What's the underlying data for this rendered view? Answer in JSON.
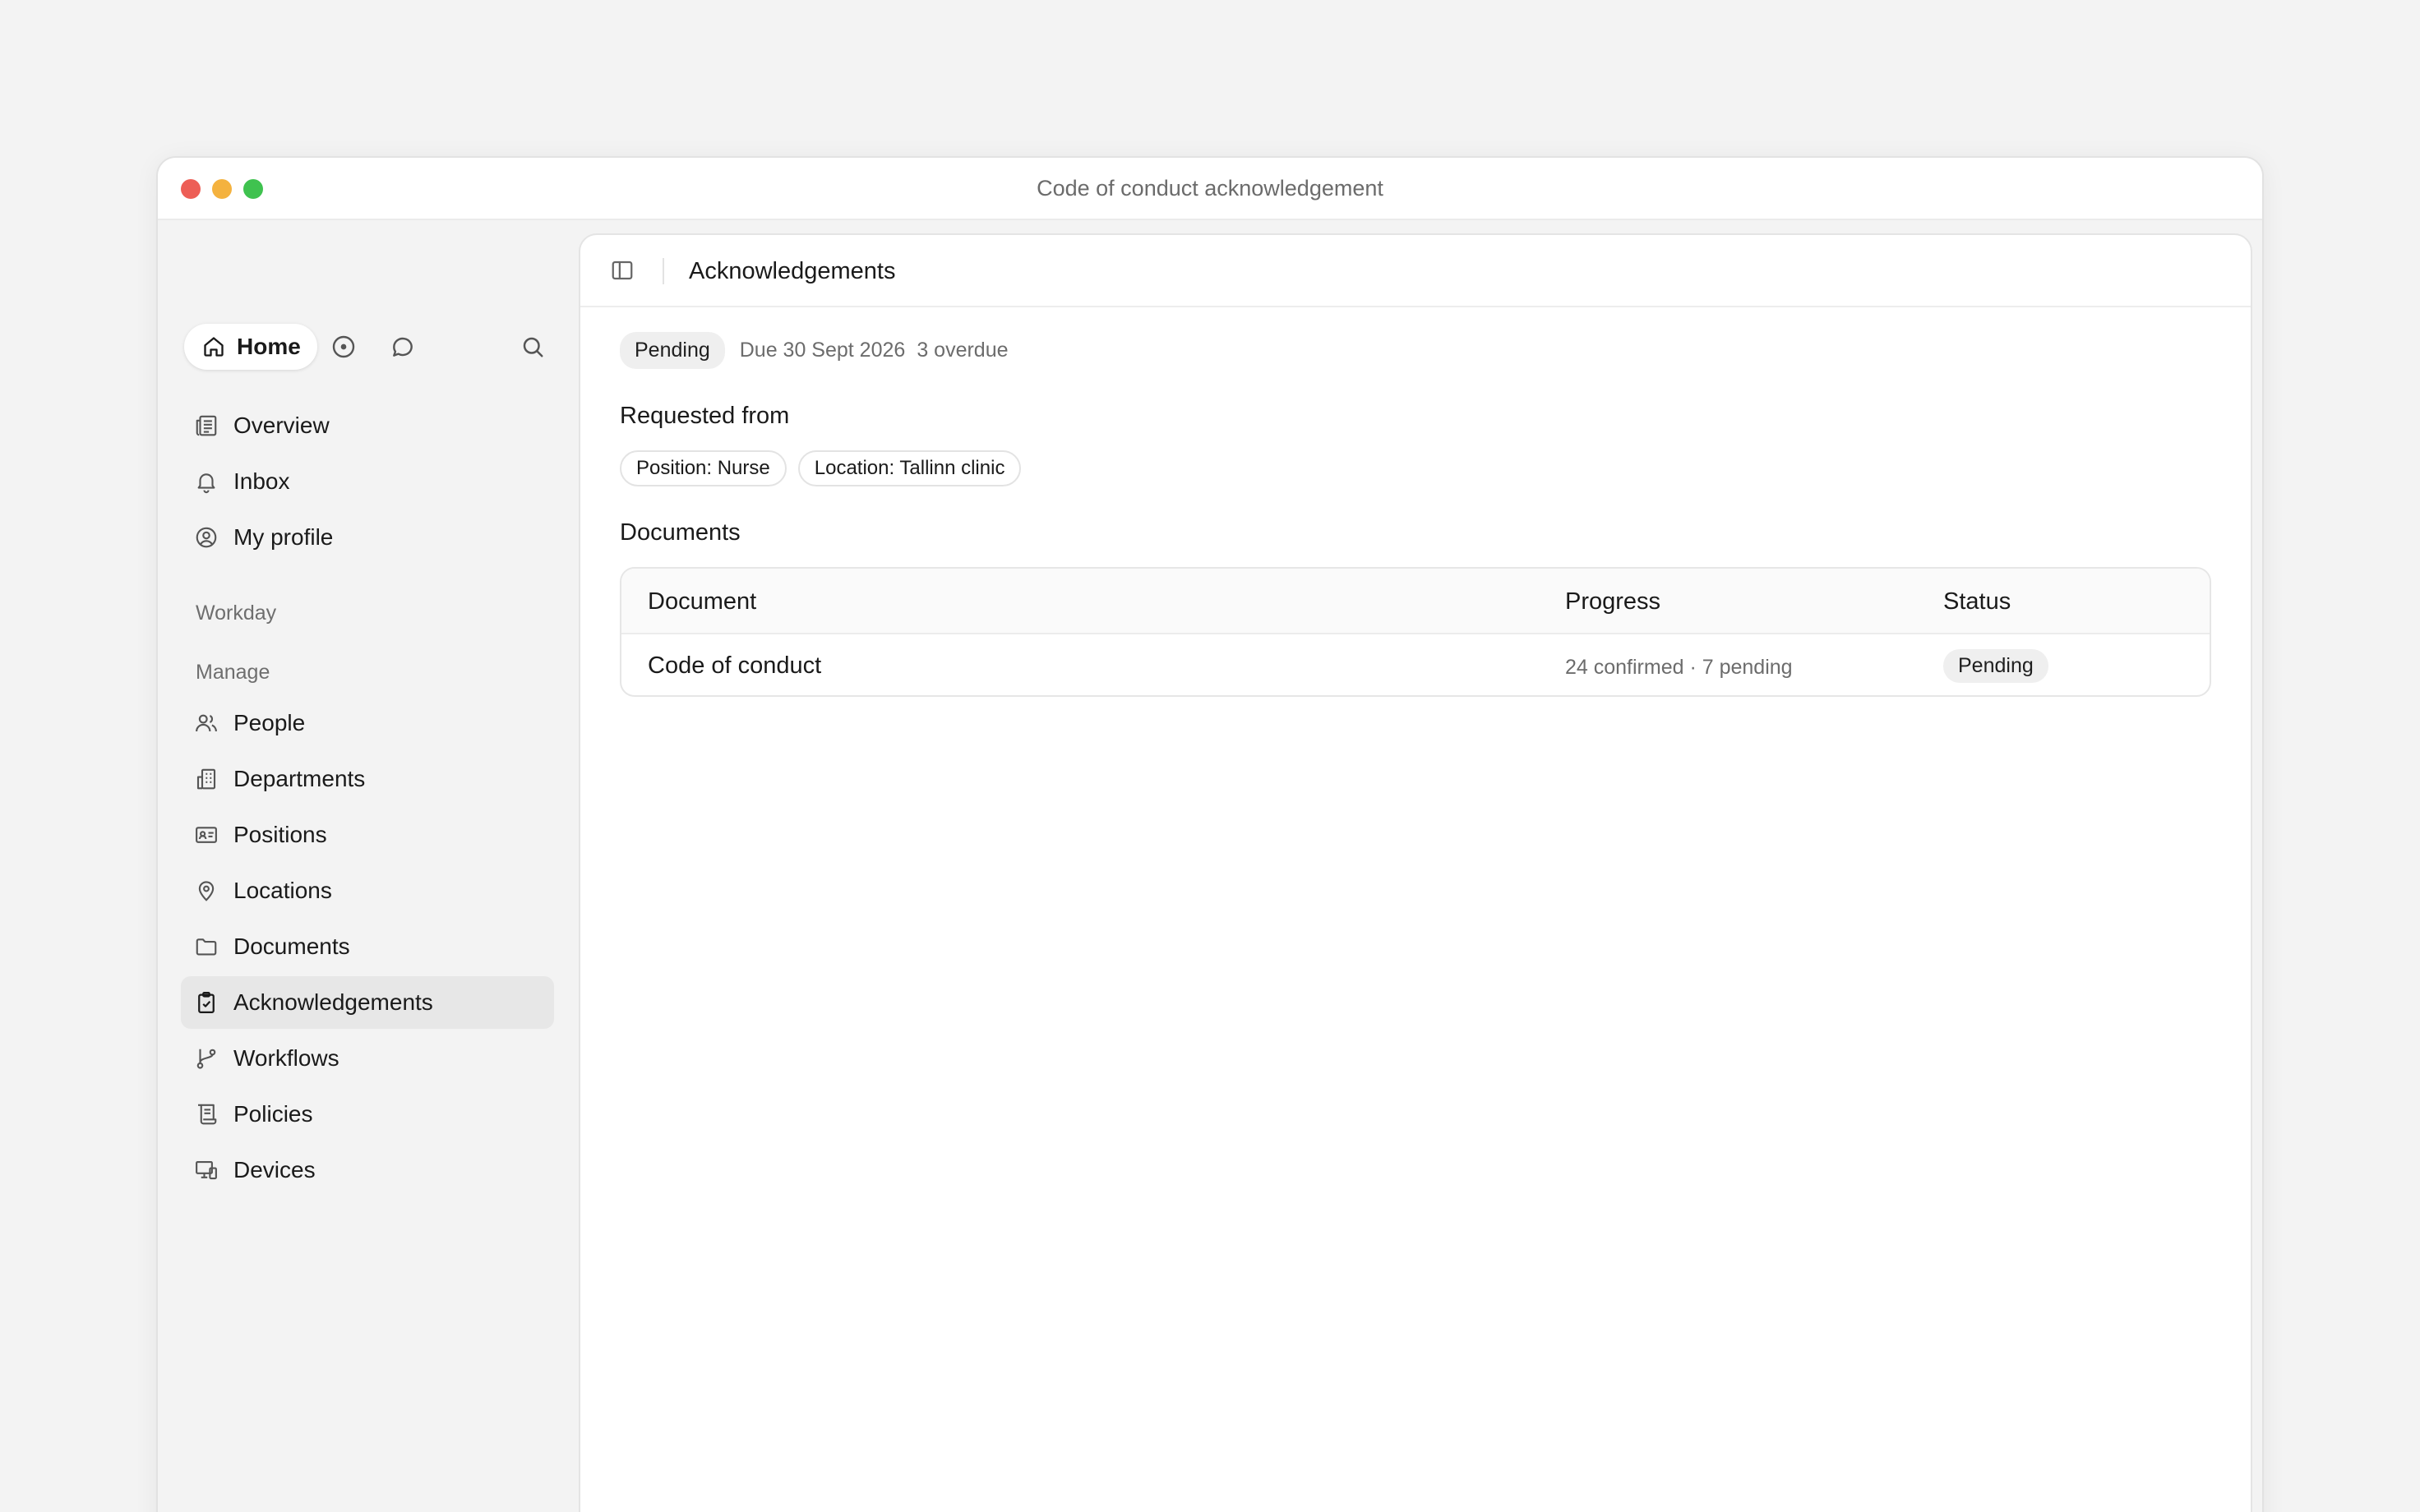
{
  "window": {
    "title": "Code of conduct acknowledgement"
  },
  "sidebar": {
    "home_label": "Home",
    "top_icons": [
      "compass-icon",
      "chat-icon",
      "search-icon"
    ],
    "primary_items": [
      {
        "label": "Overview",
        "icon": "newspaper-icon"
      },
      {
        "label": "Inbox",
        "icon": "bell-icon"
      },
      {
        "label": "My profile",
        "icon": "user-circle-icon"
      }
    ],
    "section_workday": "Workday",
    "section_manage": "Manage",
    "manage_items": [
      {
        "label": "People",
        "icon": "users-icon"
      },
      {
        "label": "Departments",
        "icon": "building-icon"
      },
      {
        "label": "Positions",
        "icon": "id-card-icon"
      },
      {
        "label": "Locations",
        "icon": "map-pin-icon"
      },
      {
        "label": "Documents",
        "icon": "folder-icon"
      },
      {
        "label": "Acknowledgements",
        "icon": "clipboard-check-icon",
        "active": true
      },
      {
        "label": "Workflows",
        "icon": "git-branch-icon"
      },
      {
        "label": "Policies",
        "icon": "scroll-icon"
      },
      {
        "label": "Devices",
        "icon": "devices-icon"
      }
    ]
  },
  "header": {
    "title": "Acknowledgements"
  },
  "meta": {
    "status": "Pending",
    "due": "Due 30 Sept 2026",
    "overdue": "3 overdue"
  },
  "requested": {
    "heading": "Requested from",
    "chips": [
      "Position: Nurse",
      "Location: Tallinn clinic"
    ]
  },
  "documents": {
    "heading": "Documents",
    "columns": [
      "Document",
      "Progress",
      "Status"
    ],
    "rows": [
      {
        "document": "Code of conduct",
        "progress": "24 confirmed · 7 pending",
        "status": "Pending"
      }
    ]
  }
}
